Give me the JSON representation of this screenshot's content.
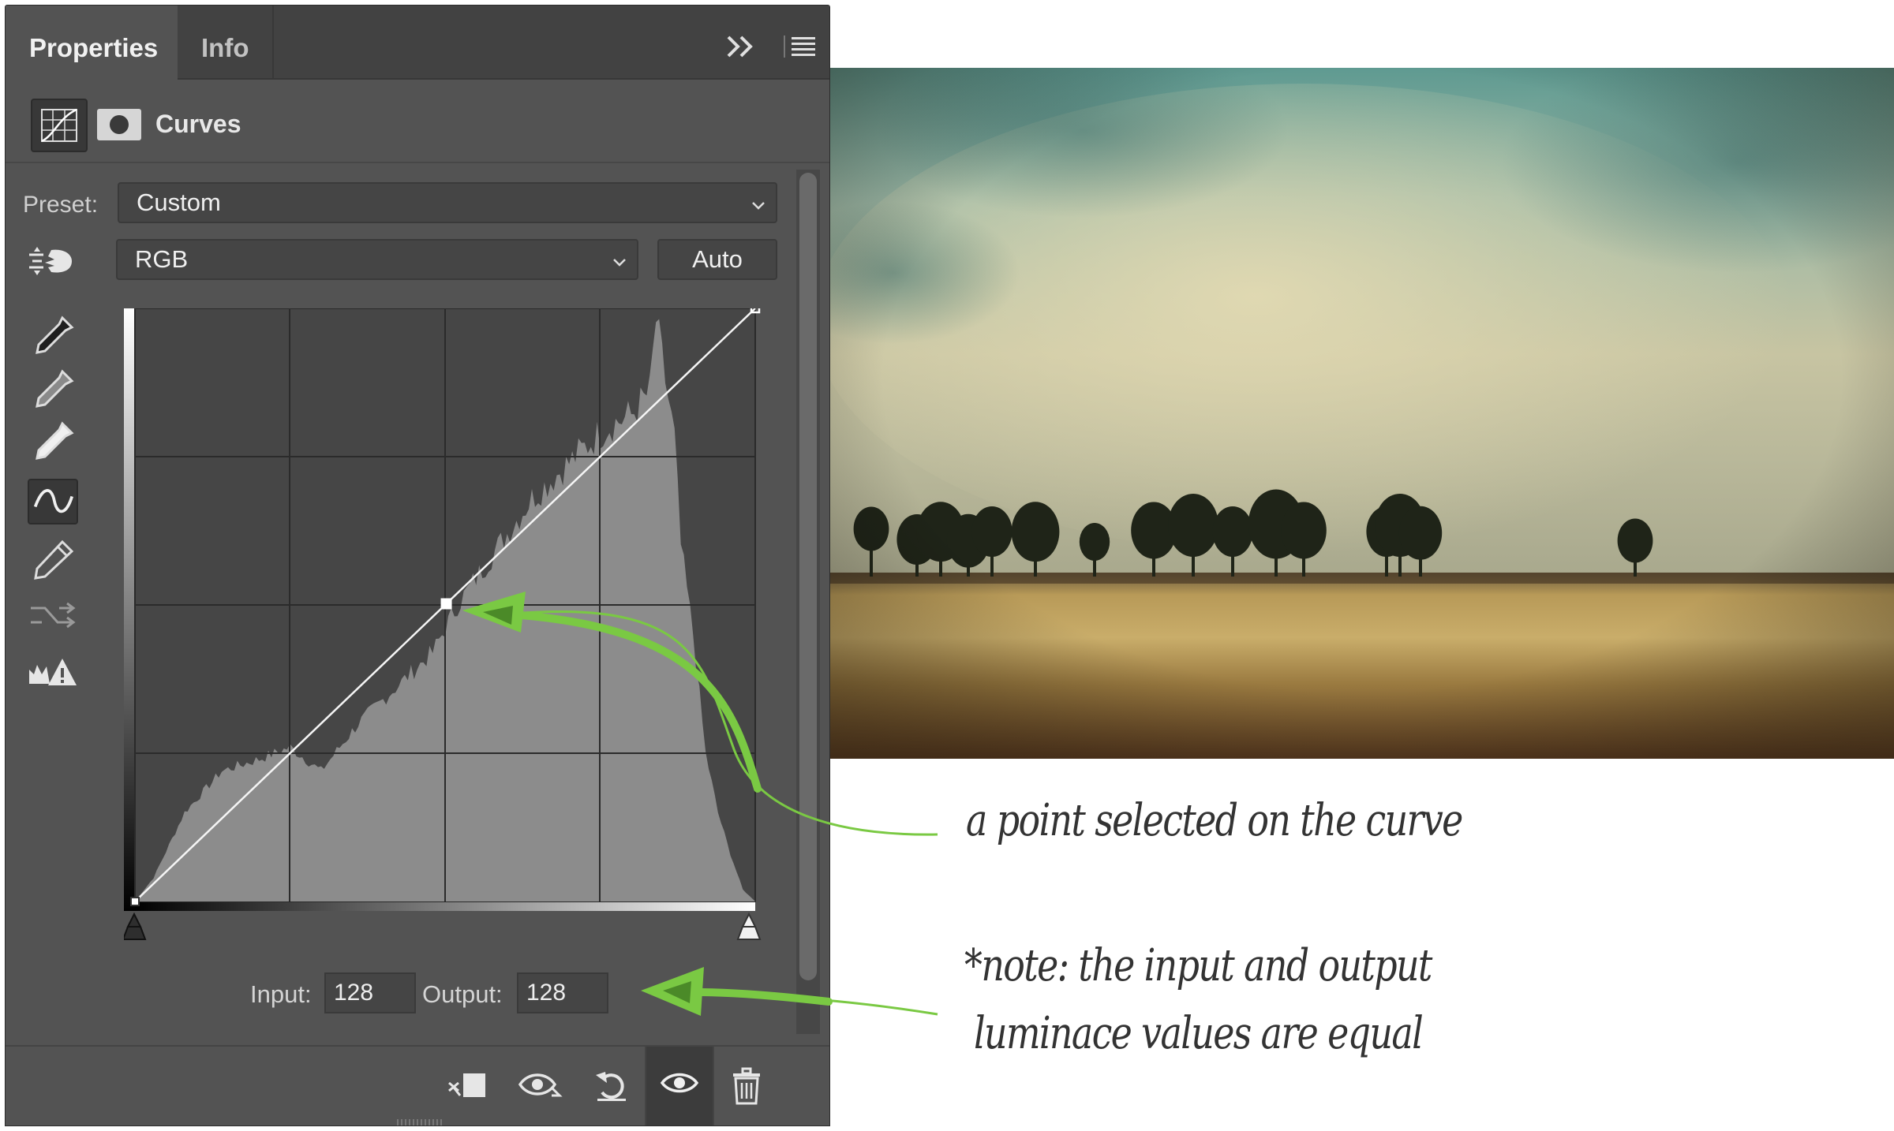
{
  "panel": {
    "tabs": [
      {
        "label": "Properties",
        "active": true
      },
      {
        "label": "Info",
        "active": false
      }
    ],
    "title": "Curves",
    "preset": {
      "label": "Preset:",
      "value": "Custom"
    },
    "channel": {
      "value": "RGB"
    },
    "auto_label": "Auto",
    "input": {
      "label": "Input:",
      "value": "128"
    },
    "output": {
      "label": "Output:",
      "value": "128"
    },
    "tools": [
      "sample-black-eyedropper-icon",
      "sample-gray-eyedropper-icon",
      "sample-white-eyedropper-icon",
      "curve-points-icon",
      "pencil-icon",
      "smooth-curve-icon",
      "clipping-warning-icon"
    ],
    "footer_buttons": [
      "clip-to-layer-icon",
      "view-previous-state-icon",
      "reset-icon",
      "toggle-visibility-icon",
      "delete-icon"
    ]
  },
  "curve": {
    "points": [
      [
        0,
        0
      ],
      [
        128,
        128
      ],
      [
        255,
        255
      ]
    ],
    "selected_point": [
      128,
      128
    ]
  },
  "annotations": {
    "point_note": "a point selected on the curve",
    "io_note_line1": "*note: the input and output",
    "io_note_line2": "luminace values are equal",
    "arrow_color": "#7ac943"
  },
  "colors": {
    "panel_bg": "#535353",
    "tabbar_bg": "#424242",
    "histogram": "#8c8c8c",
    "graph_bg": "#464646"
  }
}
